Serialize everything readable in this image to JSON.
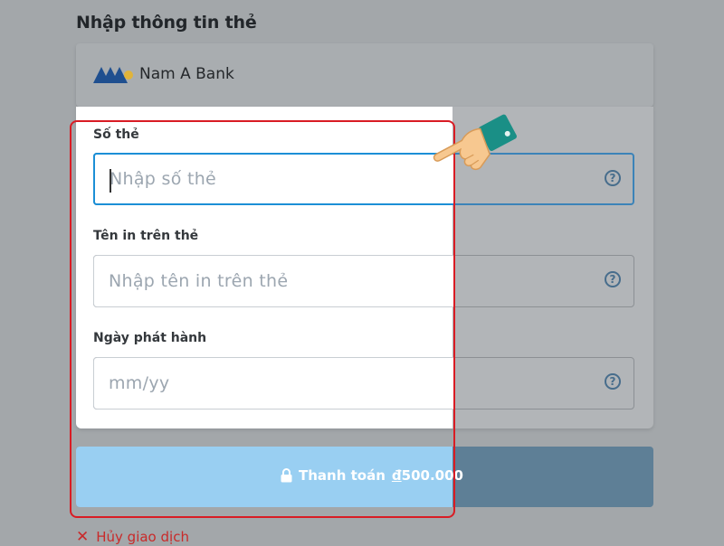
{
  "page": {
    "title": "Nhập thông tin thẻ"
  },
  "bank": {
    "name": "Nam A Bank",
    "logo_icon": "nam-a-bank-logo"
  },
  "form": {
    "fields": [
      {
        "label": "Số thẻ",
        "placeholder": "Nhập số thẻ",
        "value": "",
        "focused": true,
        "help_icon": "question-circle-icon"
      },
      {
        "label": "Tên in trên thẻ",
        "placeholder": "Nhập tên in trên thẻ",
        "value": "",
        "focused": false,
        "help_icon": "question-circle-icon"
      },
      {
        "label": "Ngày phát hành",
        "placeholder": "mm/yy",
        "value": "",
        "focused": false,
        "help_icon": "question-circle-icon"
      }
    ]
  },
  "pay": {
    "label": "Thanh toán",
    "currency": "đ",
    "amount": "500.000",
    "icon": "lock-icon"
  },
  "cancel": {
    "label": "Hủy giao dịch",
    "icon": "close-x-icon"
  },
  "help_glyph": "?",
  "colors": {
    "overlay": "#a3a7aa",
    "focus_border": "#1c8fd6",
    "pay_button": "#99cff2",
    "highlight_frame": "#d91c24",
    "cancel": "#c92a2a"
  }
}
